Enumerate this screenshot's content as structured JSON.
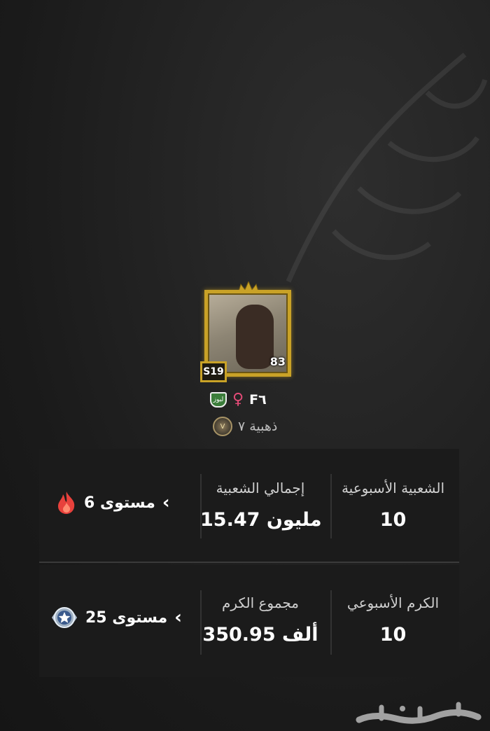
{
  "profile": {
    "level": "83",
    "season": "S19",
    "code": "F٦",
    "gender_symbol": "♀",
    "flag_label": "لبوز",
    "rank": "ذهبية ٧",
    "rank_icon_glyph": "V"
  },
  "popularity": {
    "weekly_label": "الشعبية الأسبوعية",
    "weekly_value": "10",
    "total_label": "إجمالي الشعبية",
    "total_value": "15.47 مليون",
    "level_text": "مستوى 6"
  },
  "generosity": {
    "weekly_label": "الكرم الأسبوعي",
    "weekly_value": "10",
    "total_label": "مجموع الكرم",
    "total_value": "350.95 ألف",
    "level_text": "مستوى 25"
  },
  "watermark": "حراج",
  "icons": {
    "chevron": "‹",
    "fire": "fire-icon",
    "star_badge": "star-badge-icon"
  },
  "colors": {
    "gold": "#c9a227",
    "panel": "#1b1b1b",
    "fire": "#e8413c",
    "gender": "#e34b77"
  }
}
